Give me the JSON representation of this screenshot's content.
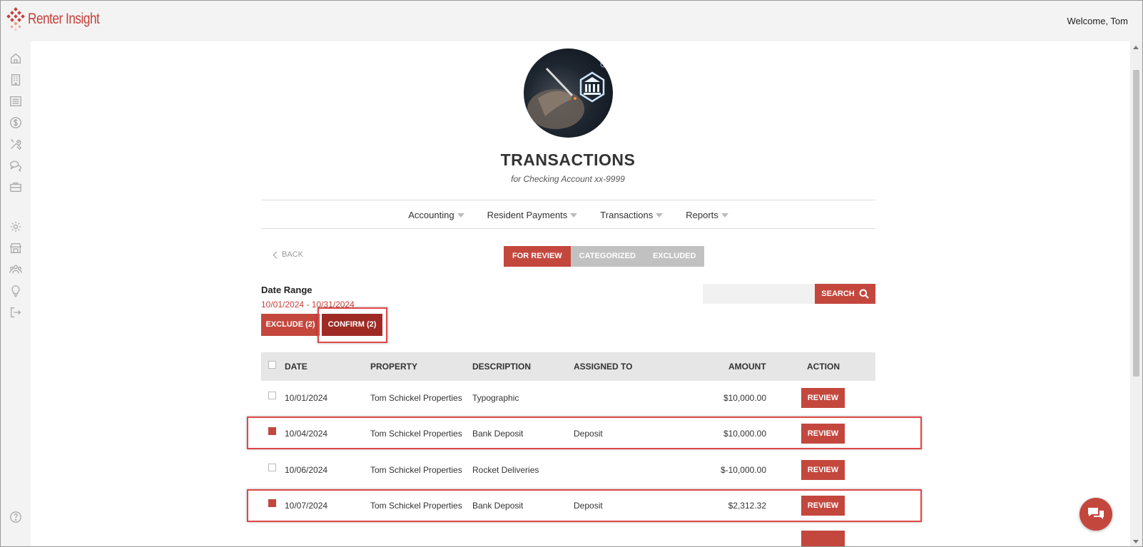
{
  "app": {
    "brand": "Renter Insight",
    "welcome": "Welcome, Tom"
  },
  "sidebar": {
    "items": [
      {
        "icon": "home-icon"
      },
      {
        "icon": "building-icon"
      },
      {
        "icon": "list-icon"
      },
      {
        "icon": "dollar-icon"
      },
      {
        "icon": "tools-icon"
      },
      {
        "icon": "chat-icon"
      },
      {
        "icon": "briefcase-icon"
      },
      {
        "icon": "gear-icon"
      },
      {
        "icon": "store-icon"
      },
      {
        "icon": "people-icon"
      },
      {
        "icon": "lightbulb-icon"
      },
      {
        "icon": "logout-icon"
      },
      {
        "icon": "help-icon"
      }
    ]
  },
  "page": {
    "title": "TRANSACTIONS",
    "subtitle": "for Checking Account xx-9999"
  },
  "nav": {
    "items": [
      "Accounting",
      "Resident Payments",
      "Transactions",
      "Reports"
    ]
  },
  "back_label": "BACK",
  "tabs": [
    {
      "label": "FOR REVIEW",
      "active": true
    },
    {
      "label": "CATEGORIZED",
      "active": false
    },
    {
      "label": "EXCLUDED",
      "active": false
    }
  ],
  "date_range": {
    "label": "Date Range",
    "value": "10/01/2024 - 10/31/2024"
  },
  "search": {
    "placeholder": "",
    "button_label": "SEARCH"
  },
  "actions": {
    "exclude_label": "EXCLUDE (2)",
    "confirm_label": "CONFIRM (2)"
  },
  "table": {
    "headers": {
      "date": "DATE",
      "property": "PROPERTY",
      "description": "DESCRIPTION",
      "assigned_to": "ASSIGNED TO",
      "amount": "AMOUNT",
      "action": "ACTION"
    },
    "rows": [
      {
        "checked": false,
        "date": "10/01/2024",
        "property": "Tom Schickel Properties",
        "description": "Typographic",
        "assigned_to": "",
        "amount": "$10,000.00",
        "action": "REVIEW"
      },
      {
        "checked": true,
        "date": "10/04/2024",
        "property": "Tom Schickel Properties",
        "description": "Bank Deposit",
        "assigned_to": "Deposit",
        "amount": "$10,000.00",
        "action": "REVIEW"
      },
      {
        "checked": false,
        "date": "10/06/2024",
        "property": "Tom Schickel Properties",
        "description": "Rocket Deliveries",
        "assigned_to": "",
        "amount": "$-10,000.00",
        "action": "REVIEW"
      },
      {
        "checked": true,
        "date": "10/07/2024",
        "property": "Tom Schickel Properties",
        "description": "Bank Deposit",
        "assigned_to": "Deposit",
        "amount": "$2,312.32",
        "action": "REVIEW"
      }
    ]
  },
  "colors": {
    "accent": "#c4473d",
    "accent_dark": "#9e2a24",
    "tab_inactive": "#c1c1c1",
    "highlight": "#e04848"
  }
}
